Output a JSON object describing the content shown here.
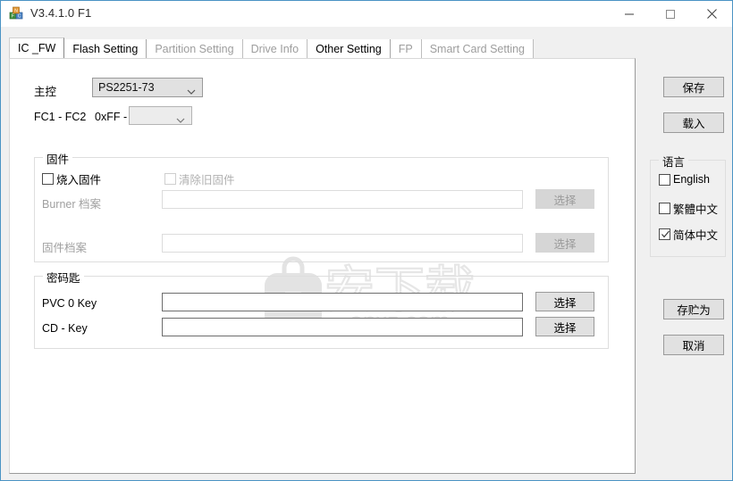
{
  "window": {
    "title": "V3.4.1.0 F1",
    "icon": "blocks-icon",
    "minimize_label": "—",
    "maximize_label": "□",
    "close_label": "✕"
  },
  "tabs": [
    {
      "label": "IC _FW",
      "state": "selected"
    },
    {
      "label": "Flash Setting",
      "state": "enabled"
    },
    {
      "label": "Partition Setting",
      "state": "disabled"
    },
    {
      "label": "Drive Info",
      "state": "disabled"
    },
    {
      "label": "Other Setting",
      "state": "enabled"
    },
    {
      "label": "FP",
      "state": "disabled"
    },
    {
      "label": "Smart Card Setting",
      "state": "disabled"
    }
  ],
  "main": {
    "controller_label": "主控",
    "controller_value": "PS2251-73",
    "fc_label": "FC1 - FC2",
    "fc_prefix": "0xFF -",
    "fc_value": "",
    "firmware_group": {
      "title": "固件",
      "burn_firmware_label": "烧入固件",
      "burn_firmware_checked": false,
      "clear_old_label": "清除旧固件",
      "clear_old_checked": false,
      "burner_file_label": "Burner 档案",
      "burner_file_value": "",
      "burner_browse_label": "选择",
      "firmware_file_label": "固件档案",
      "firmware_file_value": "",
      "firmware_browse_label": "选择"
    },
    "key_group": {
      "title": "密码匙",
      "pvc_label": "PVC 0 Key",
      "pvc_value": "",
      "pvc_browse_label": "选择",
      "cd_label": "CD - Key",
      "cd_value": "",
      "cd_browse_label": "选择"
    }
  },
  "sidebar": {
    "save_label": "保存",
    "load_label": "载入",
    "language_group_title": "语言",
    "languages": [
      {
        "label": "English",
        "checked": false
      },
      {
        "label": "繁體中文",
        "checked": false
      },
      {
        "label": "简体中文",
        "checked": true
      }
    ],
    "save_as_label": "存贮为",
    "cancel_label": "取消"
  },
  "watermark": {
    "text": "anxz.com",
    "cn_text": "安下载"
  },
  "colors": {
    "window_border": "#4a93c4",
    "panel_bg": "#f0f0f0",
    "content_bg": "#ffffff",
    "button_face": "#e1e1e1",
    "disabled_text": "#9b9b9b"
  }
}
